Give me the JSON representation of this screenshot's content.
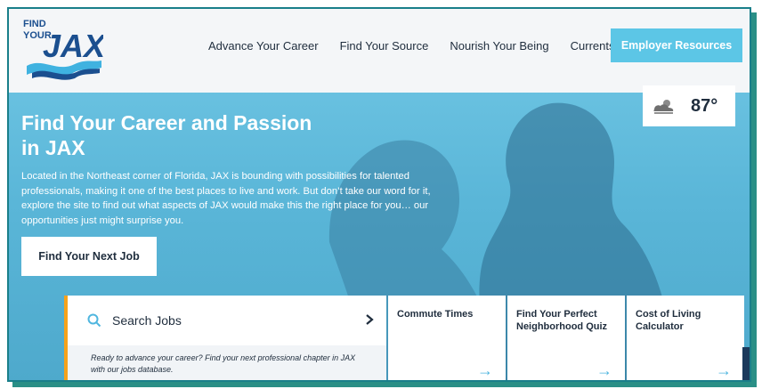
{
  "logo": {
    "line1": "FIND",
    "line2": "YOUR",
    "word": "JAX"
  },
  "nav": {
    "items": [
      {
        "label": "Advance Your Career"
      },
      {
        "label": "Find Your Source"
      },
      {
        "label": "Nourish Your Being"
      },
      {
        "label": "Currents"
      }
    ],
    "cta": "Employer Resources"
  },
  "weather": {
    "icon": "partly-cloudy-icon",
    "temperature": "87°"
  },
  "hero": {
    "title": "Find Your Career and Passion in JAX",
    "description": "Located in the Northeast corner of Florida, JAX is bounding with possibilities for talented professionals, making it one of the best places to live and work. But don’t take our word for it, explore the site to find out what aspects of JAX would make this the right place for you… our opportunities just might surprise you.",
    "button": "Find Your Next Job"
  },
  "search": {
    "label": "Search Jobs",
    "note": "Ready to advance your career? Find your next professional chapter in JAX with our jobs database."
  },
  "tiles": [
    {
      "label": "Commute Times"
    },
    {
      "label": "Find Your Perfect Neighborhood Quiz"
    },
    {
      "label": "Cost of Living Calculator"
    }
  ],
  "colors": {
    "accent": "#5cc6e6",
    "navy": "#1f2d3d",
    "orange": "#f6a21b",
    "hero": "#5ab6d8"
  }
}
